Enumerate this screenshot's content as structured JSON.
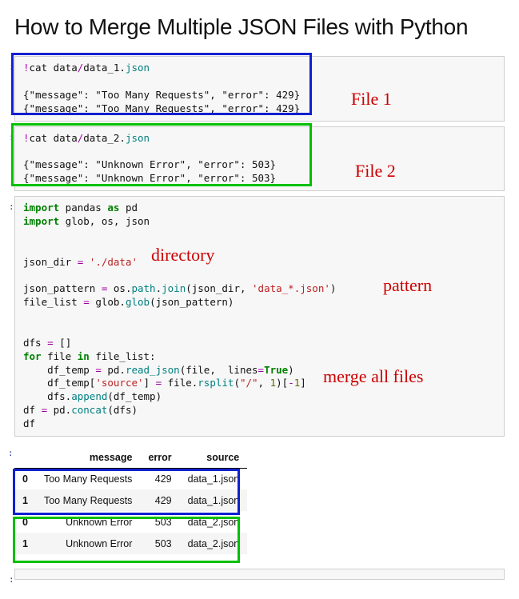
{
  "title": "How to Merge Multiple JSON Files with Python",
  "annotations": {
    "file1": "File 1",
    "file2": "File 2",
    "directory": "directory",
    "pattern": "pattern",
    "merge": "merge all files"
  },
  "cells": {
    "cat1_cmd_bang": "!",
    "cat1_cmd_rest": "cat data",
    "cat1_cmd_slash": "/",
    "cat1_cmd_file": "data_1.",
    "cat1_cmd_ext": "json",
    "cat1_out1": "{\"message\": \"Too Many Requests\", \"error\": 429}",
    "cat1_out2": "{\"message\": \"Too Many Requests\", \"error\": 429}",
    "cat2_cmd_bang": "!",
    "cat2_cmd_rest": "cat data",
    "cat2_cmd_slash": "/",
    "cat2_cmd_file": "data_2.",
    "cat2_cmd_ext": "json",
    "cat2_out1": "{\"message\": \"Unknown Error\", \"error\": 503}",
    "cat2_out2": "{\"message\": \"Unknown Error\", \"error\": 503}"
  },
  "code": {
    "line1a": "import",
    "line1b": " pandas ",
    "line1c": "as",
    "line1d": " pd",
    "line2a": "import",
    "line2b": " glob, os, json",
    "line4a": "json_dir ",
    "line4b": "=",
    "line4c": " ",
    "line4d": "'./data'",
    "line6a": "json_pattern ",
    "line6b": "=",
    "line6c": " os.",
    "line6d": "path",
    "line6e": ".",
    "line6f": "join",
    "line6g": "(json_dir, ",
    "line6h": "'data_*.json'",
    "line6i": ")",
    "line7a": "file_list ",
    "line7b": "=",
    "line7c": " glob.",
    "line7d": "glob",
    "line7e": "(json_pattern)",
    "line9a": "dfs ",
    "line9b": "=",
    "line9c": " []",
    "line10a": "for",
    "line10b": " file ",
    "line10c": "in",
    "line10d": " file_list:",
    "line11a": "    df_temp ",
    "line11b": "=",
    "line11c": " pd.",
    "line11d": "read_json",
    "line11e": "(file,  lines",
    "line11f": "=",
    "line11g": "True",
    "line11h": ")",
    "line12a": "    df_temp[",
    "line12b": "'source'",
    "line12c": "] ",
    "line12d": "=",
    "line12e": " file.",
    "line12f": "rsplit",
    "line12g": "(",
    "line12h": "\"/\"",
    "line12i": ", ",
    "line12j": "1",
    "line12k": ")[",
    "line12l": "-",
    "line12m": "1",
    "line12n": "]",
    "line13a": "    dfs.",
    "line13b": "append",
    "line13c": "(df_temp)",
    "line14a": "df ",
    "line14b": "=",
    "line14c": " pd.",
    "line14d": "concat",
    "line14e": "(dfs)",
    "line15": "df"
  },
  "table": {
    "headers": {
      "blank": "",
      "c1": "message",
      "c2": "error",
      "c3": "source"
    },
    "rows": [
      {
        "idx": "0",
        "message": "Too Many Requests",
        "error": "429",
        "source": "data_1.json"
      },
      {
        "idx": "1",
        "message": "Too Many Requests",
        "error": "429",
        "source": "data_1.json"
      },
      {
        "idx": "0",
        "message": "Unknown Error",
        "error": "503",
        "source": "data_2.json"
      },
      {
        "idx": "1",
        "message": "Unknown Error",
        "error": "503",
        "source": "data_2.json"
      }
    ]
  },
  "chart_data": {
    "type": "table",
    "title": "How to Merge Multiple JSON Files with Python",
    "columns": [
      "message",
      "error",
      "source"
    ],
    "rows": [
      [
        "Too Many Requests",
        429,
        "data_1.json"
      ],
      [
        "Too Many Requests",
        429,
        "data_1.json"
      ],
      [
        "Unknown Error",
        503,
        "data_2.json"
      ],
      [
        "Unknown Error",
        503,
        "data_2.json"
      ]
    ]
  }
}
